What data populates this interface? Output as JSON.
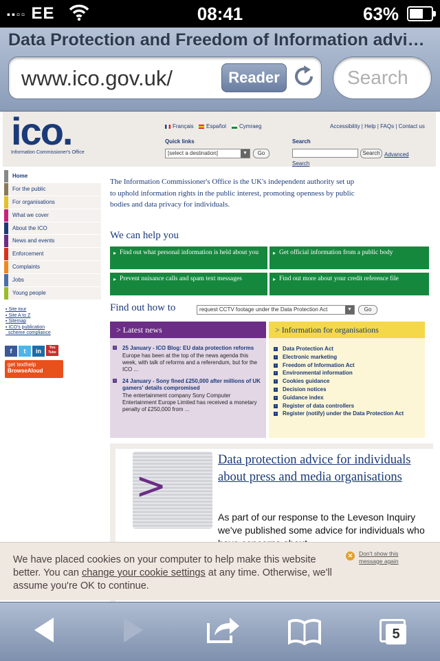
{
  "status_bar": {
    "carrier": "EE",
    "time": "08:41",
    "battery": "63%",
    "battery_level": 0.63
  },
  "browser": {
    "page_title": "Data Protection and Freedom of Information advice - ICO",
    "url": "www.ico.gov.uk/",
    "reader_label": "Reader",
    "search_placeholder": "Search",
    "tab_count": "5"
  },
  "header": {
    "logo": "ico.",
    "logo_subtitle": "Information Commissioner's Office",
    "languages": [
      "Français",
      "Español",
      "Cymraeg"
    ],
    "utility_links": "Accessibility | Help | FAQs | Contact us",
    "quick_links_label": "Quick links",
    "quick_links_value": "[select a destination]",
    "go_label": "Go",
    "search_label": "Search",
    "search_button": "Search",
    "advanced_link": "Advanced",
    "search_link": "Search"
  },
  "nav": {
    "items": [
      {
        "label": "Home",
        "color": "#ffffff"
      },
      {
        "label": "For the public",
        "color": "#8a7a5a"
      },
      {
        "label": "For organisations",
        "color": "#e3c12a"
      },
      {
        "label": "What we cover",
        "color": "#c8227a"
      },
      {
        "label": "About the ICO",
        "color": "#1b3a78"
      },
      {
        "label": "News and events",
        "color": "#6b2d85"
      },
      {
        "label": "Enforcement",
        "color": "#d8321e"
      },
      {
        "label": "Complaints",
        "color": "#ec8a1e"
      },
      {
        "label": "Jobs",
        "color": "#4a6fa8"
      },
      {
        "label": "Young people",
        "color": "#9bbb2a"
      }
    ]
  },
  "side_links": [
    "Site tour",
    "Site A to Z",
    "Sitemap",
    "ICO's publication",
    "scheme compliance"
  ],
  "social": {
    "facebook": "f",
    "twitter": "t",
    "linkedin": "in",
    "youtube": "You Tube"
  },
  "browsealoud": {
    "line1": "get texthelp",
    "line2": "BrowseAloud"
  },
  "intro": "The Information Commissioner's Office is the UK's independent authority set up to uphold information rights in the public interest, promoting openness by public bodies and data privacy for individuals.",
  "help": {
    "heading": "We can help you",
    "boxes": [
      "Find out what personal information is held about you",
      "Get official information from a public body",
      "Prevent nuisance calls and spam text messages",
      "Find out more about your credit reference file"
    ]
  },
  "find_out": {
    "label": "Find out how to",
    "value": "request CCTV footage under the Data Protection Act",
    "go_label": "Go"
  },
  "latest_news": {
    "heading": "> Latest news",
    "items": [
      {
        "title": "25 January - ICO Blog: EU data protection reforms",
        "desc": "Europe has been at the top of the news agenda this week, with talk of reforms and a referendum, but for the ICO ..."
      },
      {
        "title": "24 January - Sony fined £250,000 after millions of UK gamers' details compromised",
        "desc": "The entertainment company Sony Computer Entertainment Europe Limited has received a monetary penalty of £250,000 from ..."
      }
    ]
  },
  "org_info": {
    "heading": "> Information for organisations",
    "items": [
      "Data Protection Act",
      "Electronic marketing",
      "Freedom of Information Act",
      "Environmental information",
      "Cookies guidance",
      "Decision notices",
      "Guidance index",
      "Register of data controllers",
      "Register (notify) under the Data Protection Act"
    ]
  },
  "feature": {
    "title": "Data protection advice for individuals about press and media organisations",
    "text": "As part of our response to the Leveson Inquiry we've published some advice for individuals who have concerns about"
  },
  "cookie": {
    "text_before": "We have placed cookies on your computer to help make this website better. You can ",
    "link": "change your cookie settings",
    "text_after": " at any time. Otherwise, we'll assume you're OK to continue.",
    "dismiss": "Don't show this message again"
  },
  "colors": {
    "ico_blue": "#1b3a78",
    "help_green": "#16883e",
    "news_purple": "#6b2d85",
    "news_bg": "#e3d7e6",
    "org_yellow": "#f4d84a",
    "org_bg": "#fcf6d6"
  },
  "icons": {
    "wifi": "wifi-icon",
    "battery": "battery-icon",
    "reload": "reload-icon",
    "back": "back-icon",
    "forward": "forward-icon",
    "share": "share-icon",
    "bookmarks": "bookmarks-icon",
    "tabs": "tabs-icon"
  }
}
